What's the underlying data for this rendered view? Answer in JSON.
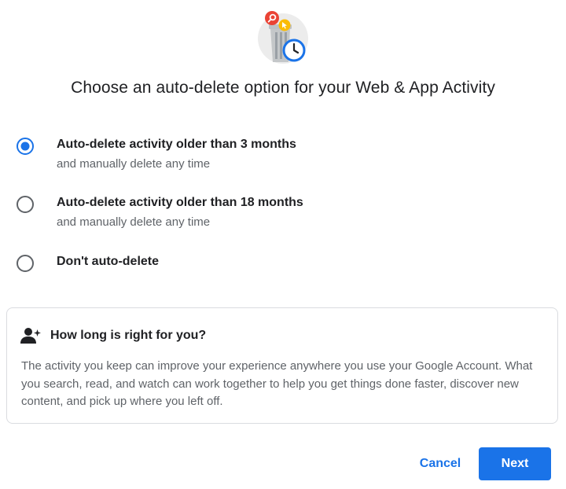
{
  "dialog": {
    "title": "Choose an auto-delete option for your Web & App Activity"
  },
  "options": [
    {
      "label": "Auto-delete activity older than 3 months",
      "sublabel": "and manually delete any time",
      "selected": true
    },
    {
      "label": "Auto-delete activity older than 18 months",
      "sublabel": "and manually delete any time",
      "selected": false
    },
    {
      "label": "Don't auto-delete",
      "sublabel": "",
      "selected": false
    }
  ],
  "info": {
    "icon": "person-sparkle-icon",
    "title": "How long is right for you?",
    "body": "The activity you keep can improve your experience anywhere you use your Google Account. What you search, read, and watch can work together to help you get things done faster, discover new content, and pick up where you left off."
  },
  "actions": {
    "cancel_label": "Cancel",
    "next_label": "Next"
  },
  "colors": {
    "accent": "#1a73e8",
    "text_primary": "#202124",
    "text_secondary": "#5f6368",
    "border": "#dadce0",
    "radio_unselected": "#5f6368"
  }
}
